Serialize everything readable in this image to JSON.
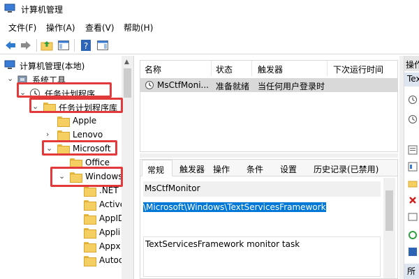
{
  "window": {
    "title": "计算机管理"
  },
  "menu": [
    "文件(F)",
    "操作(A)",
    "查看(V)",
    "帮助(H)"
  ],
  "tree": {
    "root": "计算机管理(本地)",
    "items": [
      {
        "label": "系统工具"
      },
      {
        "label": "任务计划程序"
      },
      {
        "label": "任务计划程序库"
      },
      {
        "label": "Apple"
      },
      {
        "label": "Lenovo"
      },
      {
        "label": "Microsoft"
      },
      {
        "label": "Office"
      },
      {
        "label": "Windows"
      },
      {
        "label": ".NET"
      },
      {
        "label": "Active"
      },
      {
        "label": "AppID"
      },
      {
        "label": "Appli"
      },
      {
        "label": "Appx"
      },
      {
        "label": "Autoc"
      }
    ]
  },
  "task_list": {
    "columns": [
      "名称",
      "状态",
      "触发器",
      "下次运行时间"
    ],
    "rows": [
      {
        "name": "MsCtfMoni...",
        "status": "准备就绪",
        "trigger": "当任何用户登录时",
        "next_run": ""
      }
    ]
  },
  "properties": {
    "tabs": [
      "常规",
      "触发器",
      "操作",
      "条件",
      "设置",
      "历史记录(已禁用)"
    ],
    "task_name": "MsCtfMonitor",
    "location": "\\Microsoft\\Windows\\TextServicesFramework",
    "description": "TextServicesFramework monitor task"
  },
  "actions_pane": {
    "header": "操作",
    "sub": "Tex",
    "bottom": "所"
  },
  "colors": {
    "highlight_border": "#e23a3a",
    "selection": "#0078d7",
    "row_selected": "#d9d9d9"
  }
}
